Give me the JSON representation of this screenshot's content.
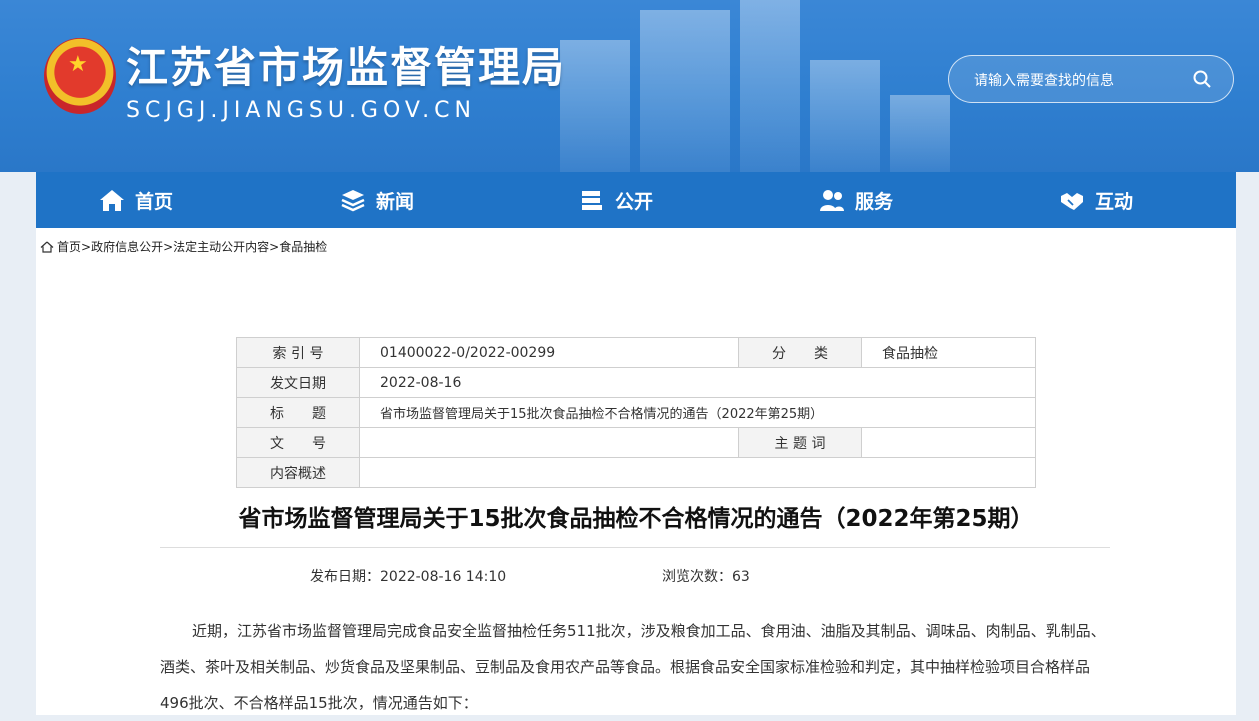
{
  "header": {
    "site_title": "江苏省市场监督管理局",
    "site_url": "SCJGJ.JIANGSU.GOV.CN",
    "search_placeholder": "请输入需要查找的信息"
  },
  "nav": {
    "items": [
      {
        "label": "首页",
        "icon": "home-icon"
      },
      {
        "label": "新闻",
        "icon": "layers-icon"
      },
      {
        "label": "公开",
        "icon": "stack-icon"
      },
      {
        "label": "服务",
        "icon": "people-icon"
      },
      {
        "label": "互动",
        "icon": "handshake-icon"
      }
    ]
  },
  "breadcrumb": [
    "首页",
    "政府信息公开",
    "法定主动公开内容",
    "食品抽检"
  ],
  "breadcrumb_sep": ">",
  "meta": {
    "index_label": "索 引 号",
    "index_value": "01400022-0/2022-00299",
    "category_label": "分　　类",
    "category_value": "食品抽检",
    "date_label": "发文日期",
    "date_value": "2022-08-16",
    "title_label": "标　　题",
    "title_value": "省市场监督管理局关于15批次食品抽检不合格情况的通告（2022年第25期）",
    "docno_label": "文　　号",
    "docno_value": "",
    "keywords_label": "主 题 词",
    "keywords_value": "",
    "summary_label": "内容概述",
    "summary_value": ""
  },
  "article": {
    "title": "省市场监督管理局关于15批次食品抽检不合格情况的通告（2022年第25期）",
    "publish_label": "发布日期：",
    "publish_value": "2022-08-16 14:10",
    "views_label": "浏览次数：",
    "views_value": "63",
    "paragraph": "近期，江苏省市场监督管理局完成食品安全监督抽检任务511批次，涉及粮食加工品、食用油、油脂及其制品、调味品、肉制品、乳制品、酒类、茶叶及相关制品、炒货食品及坚果制品、豆制品及食用农产品等食品。根据食品安全国家标准检验和判定，其中抽样检验项目合格样品496批次、不合格样品15批次，情况通告如下："
  },
  "colors": {
    "banner": "#2f7fd0",
    "nav": "#1f73c6"
  }
}
